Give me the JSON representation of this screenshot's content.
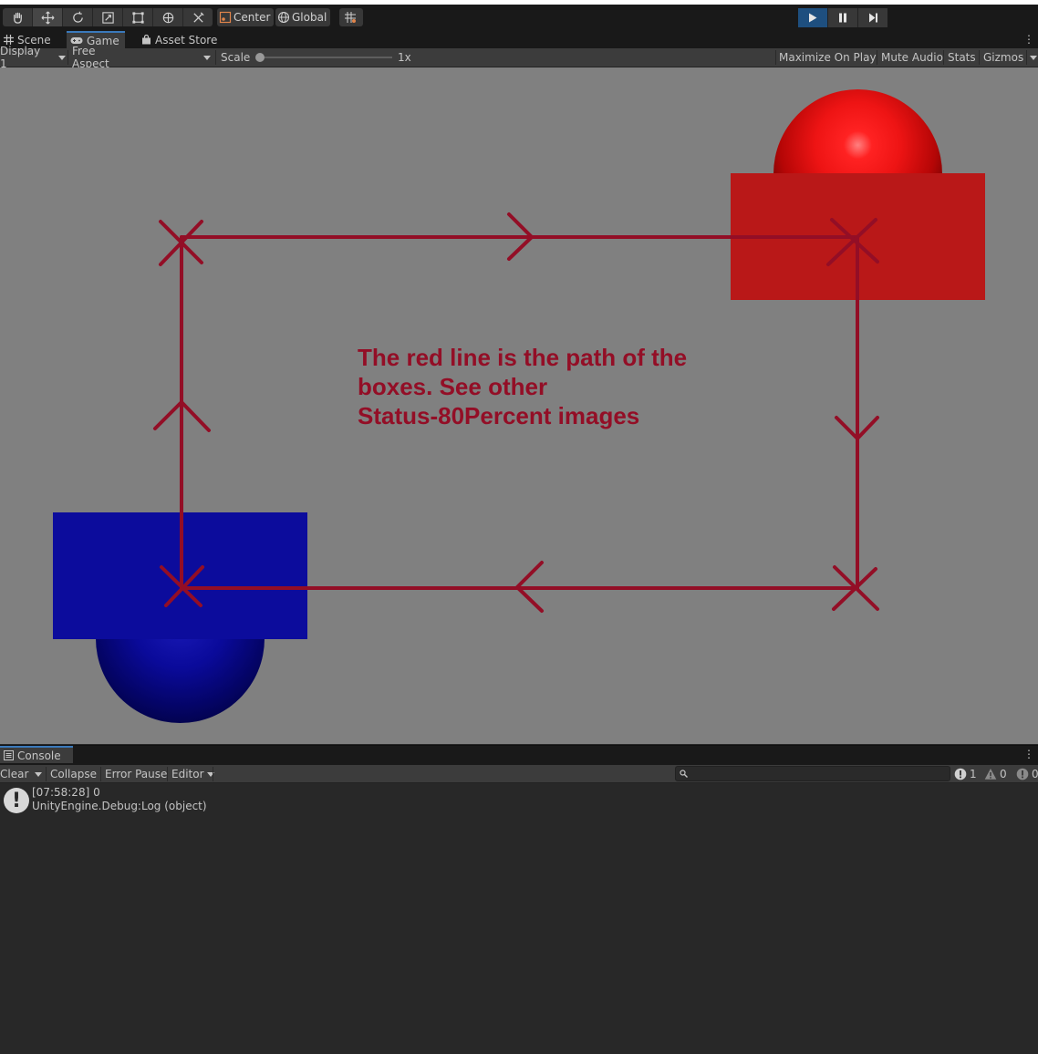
{
  "toolbar": {
    "tools": [
      "hand-tool-icon",
      "move-tool-icon",
      "rotate-tool-icon",
      "scale-tool-icon",
      "rect-tool-icon",
      "transform-tool-icon",
      "custom-tool-icon"
    ],
    "active_tool": "move-tool-icon",
    "pivot_mode": "Center",
    "pivot_rotation": "Global",
    "play_active": true
  },
  "tabs": {
    "scene": "Scene",
    "game": "Game",
    "asset_store": "Asset Store"
  },
  "game_controls": {
    "display": "Display 1",
    "aspect": "Free Aspect",
    "scale_label": "Scale",
    "scale_value": "1x",
    "maximize_on_play": "Maximize On Play",
    "mute_audio": "Mute Audio",
    "stats": "Stats",
    "gizmos": "Gizmos"
  },
  "game_view": {
    "note_lines": [
      "The red line is the path of the",
      "boxes. See other",
      "Status-80Percent images"
    ],
    "path_color": "#930e26",
    "red_color": "#b91818",
    "blue_color": "#0c0c9c",
    "background_color": "#808080"
  },
  "console": {
    "tab": "Console",
    "clear": "Clear",
    "collapse": "Collapse",
    "error_pause": "Error Pause",
    "editor": "Editor",
    "search_placeholder": "",
    "log_count": "1",
    "warning_count": "0",
    "error_count": "0",
    "entries": [
      {
        "time": "[07:58:28] 0",
        "detail": "UnityEngine.Debug:Log (object)"
      }
    ]
  }
}
